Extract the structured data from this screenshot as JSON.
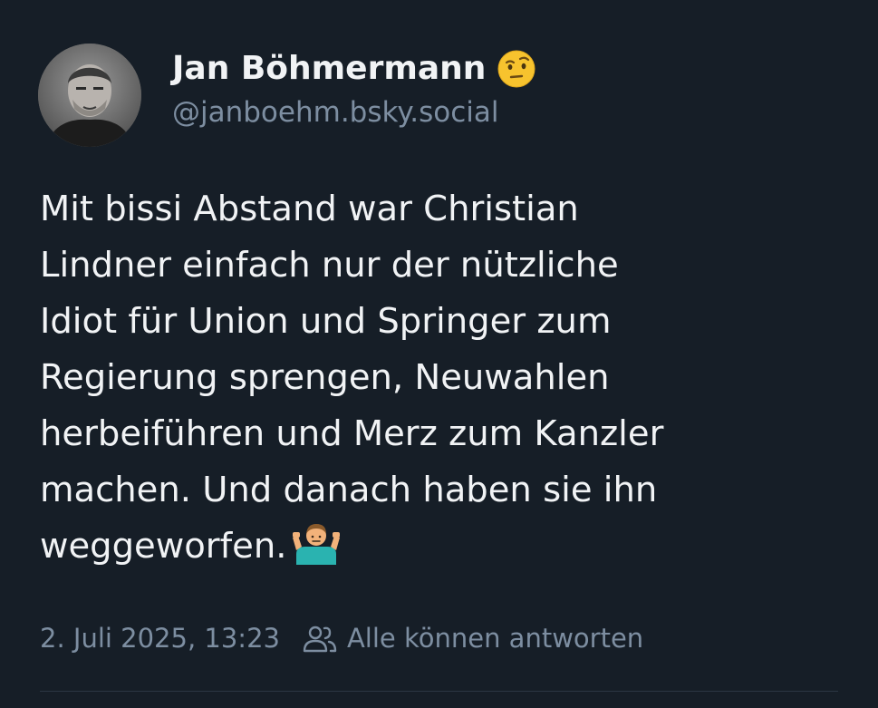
{
  "post": {
    "author": {
      "display_name": "Jan Böhmermann",
      "name_emoji": "face-with-raised-eyebrow-emoji",
      "handle": "@janboehm.bsky.social"
    },
    "text_lines": [
      "Mit bissi Abstand war Christian",
      "Lindner einfach nur der nützliche",
      "Idiot für Union und Springer zum",
      "Regierung sprengen, Neuwahlen",
      "herbeiführen und Merz zum Kanzler",
      "machen. Und danach haben sie ihn",
      "weggeworfen."
    ],
    "text_emoji": "person-shrugging-emoji",
    "timestamp": "2. Juli 2025, 13:23",
    "reply_setting": "Alle können antworten",
    "reply_setting_icon": "people-icon"
  },
  "colors": {
    "background": "#161e27",
    "text": "#f1f3f5",
    "muted": "#7d8ea1"
  }
}
